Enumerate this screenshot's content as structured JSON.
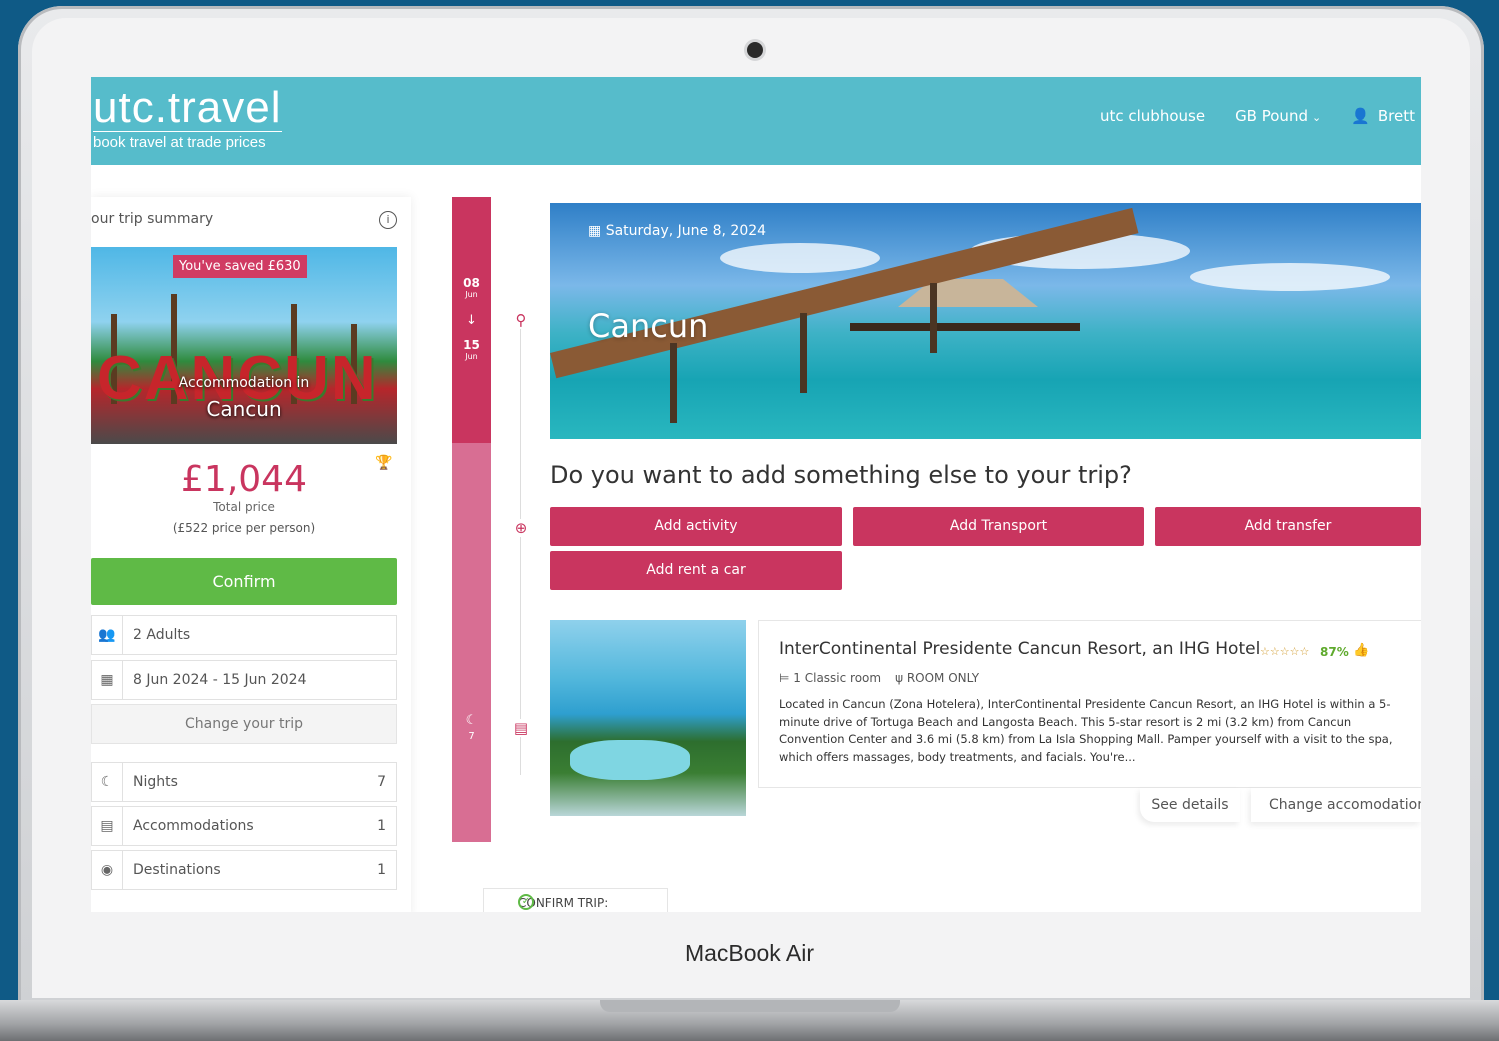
{
  "device": {
    "brand": "MacBook Air"
  },
  "header": {
    "logo_main": "utc.travel",
    "logo_tagline": "book travel at trade prices",
    "nav": {
      "clubhouse": "utc clubhouse",
      "currency": "GB Pound",
      "user": "Brett"
    }
  },
  "summary": {
    "title": "our trip summary",
    "saved_badge": "You've saved £630",
    "image_label": "Accommodation in",
    "image_city": "Cancun",
    "price": "£1,044",
    "price_label": "Total price",
    "price_per_person": "(£522 price per person)",
    "confirm_label": "Confirm",
    "travellers": "2 Adults",
    "dates": "8 Jun 2024 - 15 Jun 2024",
    "change_trip_label": "Change your trip",
    "stats": [
      {
        "label": "Nights",
        "value": "7"
      },
      {
        "label": "Accommodations",
        "value": "1"
      },
      {
        "label": "Destinations",
        "value": "1"
      }
    ]
  },
  "timeline": {
    "start_day": "08",
    "start_month": "Jun",
    "end_day": "15",
    "end_month": "Jun",
    "nights": "7"
  },
  "hero": {
    "date": "Saturday, June 8, 2024",
    "city": "Cancun"
  },
  "addons": {
    "question": "Do you want to add something else to your trip?",
    "buttons": [
      "Add activity",
      "Add Transport",
      "Add transfer",
      "Add rent a car"
    ]
  },
  "hotel": {
    "name": "InterContinental Presidente Cancun Resort, an IHG Hotel",
    "stars": "☆☆☆☆☆",
    "rating": "87%",
    "room": "1 Classic room",
    "board": "ROOM ONLY",
    "description": "Located in Cancun (Zona Hotelera), InterContinental Presidente Cancun Resort, an IHG Hotel is within a 5-minute drive of Tortuga Beach and Langosta Beach. This 5-star resort is 2 mi (3.2 km) from Cancun Convention Center and 3.6 mi (5.8 km) from La Isla Shopping Mall. Pamper yourself with a visit to the spa, which offers massages, body treatments, and facials. You're...",
    "see_details": "See details",
    "change_accommodation": "Change accomodation"
  },
  "footer": {
    "confirm_trip": "CONFIRM TRIP:"
  },
  "colors": {
    "header": "#56bccb",
    "accent": "#c9355f",
    "confirm": "#5fba46",
    "background": "#0f5a86"
  }
}
